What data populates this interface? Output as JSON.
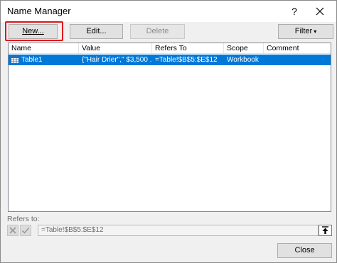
{
  "window": {
    "title": "Name Manager",
    "help_label": "?"
  },
  "toolbar": {
    "new_label": "New...",
    "edit_label": "Edit...",
    "delete_label": "Delete",
    "filter_label": "Filter",
    "filter_caret": "▾"
  },
  "list": {
    "columns": [
      "Name",
      "Value",
      "Refers To",
      "Scope",
      "Comment"
    ],
    "rows": [
      {
        "name": "Table1",
        "value": "{\"Hair Drier\",\" $3,500 ...",
        "refers_to": "=Table!$B$5:$E$12",
        "scope": "Workbook",
        "comment": ""
      }
    ]
  },
  "refers_to": {
    "label": "Refers to:",
    "value": "=Table!$B$5:$E$12"
  },
  "footer": {
    "close_label": "Close"
  },
  "colors": {
    "selection": "#0078d7",
    "highlight_border": "#e0141b"
  }
}
